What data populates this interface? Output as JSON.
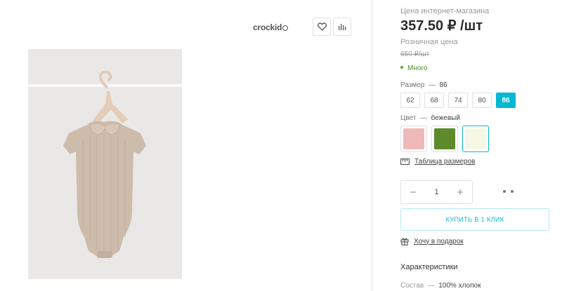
{
  "brand": {
    "logo_text": "crockid"
  },
  "gallery": {
    "favorite_icon": "heart-icon",
    "compare_icon": "bar-chart-icon",
    "product_image": "beige short-sleeve bodysuit with peter pan collar on a hanger"
  },
  "pricing": {
    "online_label": "Цена интернет-магазина",
    "online_price": "357.50 ₽ /шт",
    "retail_label": "Розничная цена",
    "retail_price": "650 ₽/шт",
    "stock_status": "Много",
    "stock_color": "#5aa52a"
  },
  "size": {
    "label": "Размер",
    "separator": "—",
    "selected": "86",
    "options": [
      "62",
      "68",
      "74",
      "80",
      "86"
    ]
  },
  "color": {
    "label": "Цвет",
    "separator": "—",
    "selected": "бежевый",
    "swatches": [
      "#efb9b9",
      "#5e8a2c",
      "#f6f7e4"
    ]
  },
  "size_table_link": "Таблица размеров",
  "quantity": {
    "value": "1",
    "minus": "−",
    "plus": "+"
  },
  "one_click_button": "КУПИТЬ В 1 КЛИК",
  "gift_link": "Хочу в подарок",
  "characteristics": {
    "title": "Характеристики",
    "composition_label": "Состав",
    "composition_separator": "—",
    "composition_value": "100% хлопок"
  },
  "accent_color": "#05b8d3"
}
